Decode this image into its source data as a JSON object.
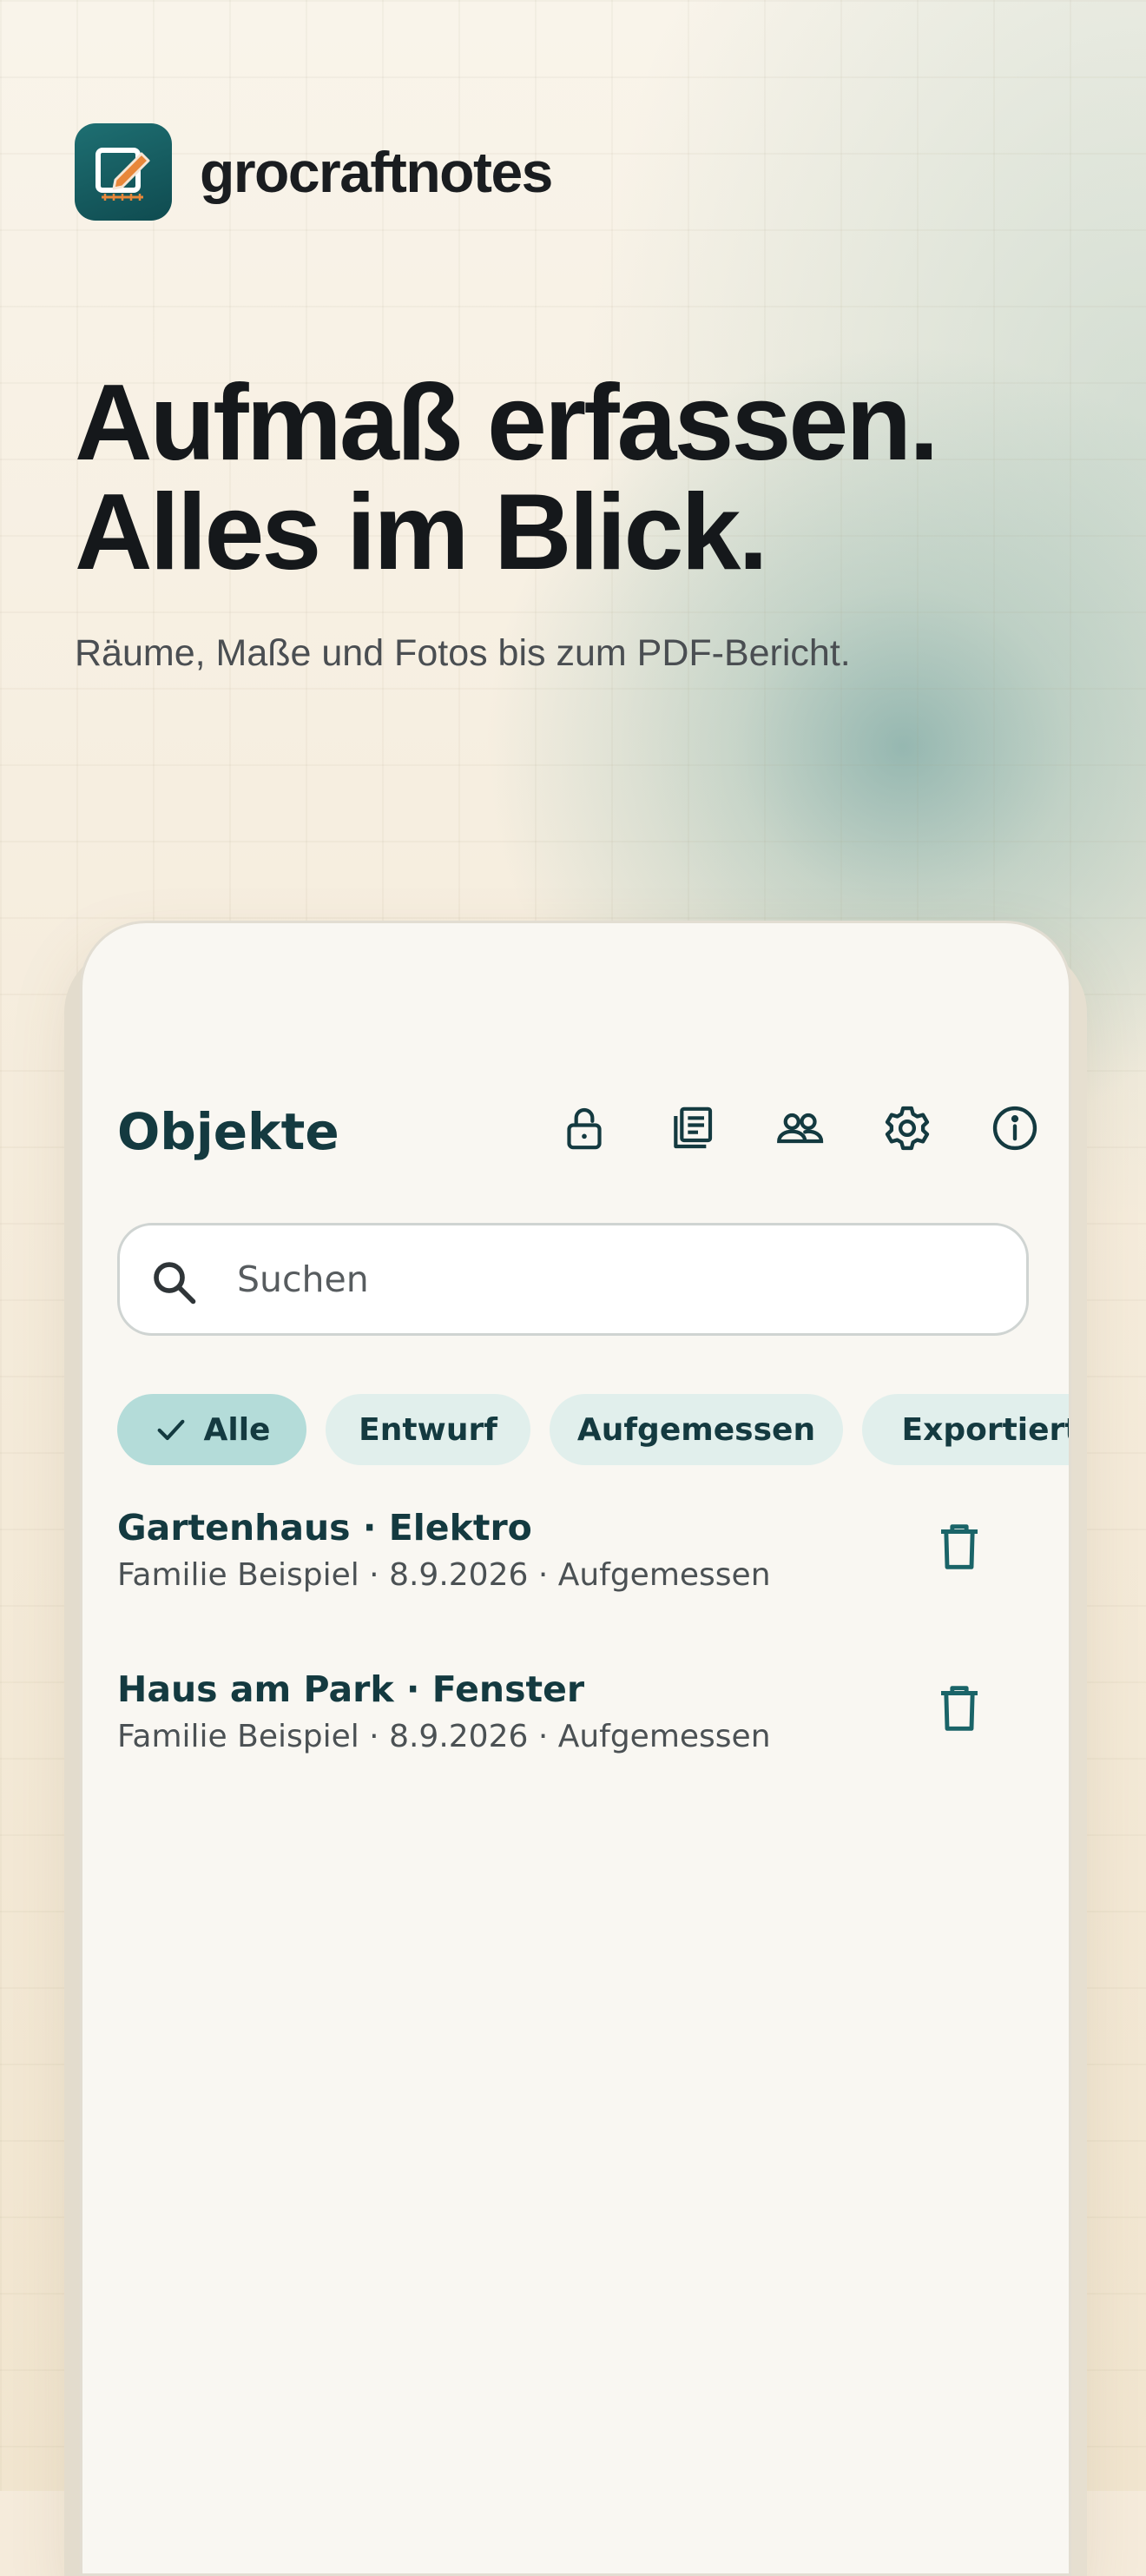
{
  "brand": {
    "name": "grocraftnotes",
    "icon": "note-edit-icon"
  },
  "hero": {
    "headline_line1": "Aufmaß erfassen.",
    "headline_line2": "Alles im Blick.",
    "subtitle": "Räume, Maße und Fotos bis zum PDF-Bericht."
  },
  "app": {
    "title": "Objekte",
    "actions": [
      "lock-open-icon",
      "list-document-icon",
      "people-icon",
      "settings-gear-icon",
      "info-icon"
    ],
    "search": {
      "placeholder": "Suchen"
    },
    "filters": [
      {
        "label": "Alle",
        "selected": true
      },
      {
        "label": "Entwurf",
        "selected": false
      },
      {
        "label": "Aufgemessen",
        "selected": false
      },
      {
        "label": "Exportiert",
        "selected": false
      }
    ],
    "items": [
      {
        "title": "Gartenhaus · Elektro",
        "subtitle": "Familie Beispiel · 8.9.2026 · Aufgemessen"
      },
      {
        "title": "Haus am Park · Fenster",
        "subtitle": "Familie Beispiel · 8.9.2026 · Aufgemessen"
      }
    ]
  },
  "colors": {
    "accent": "#143a40",
    "chip_selected": "#b4dcd9",
    "chip": "#e1efec",
    "icon_bg": "#1a6468",
    "pencil": "#e8873a"
  }
}
